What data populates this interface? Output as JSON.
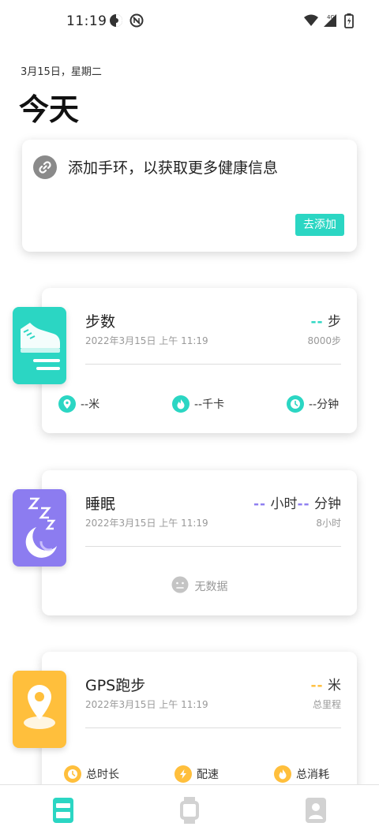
{
  "status_bar": {
    "time": "11:19"
  },
  "header": {
    "date": "3月15日，星期二",
    "title": "今天"
  },
  "add_band": {
    "message": "添加手环，以获取更多健康信息",
    "button": "去添加"
  },
  "steps": {
    "title": "步数",
    "timestamp": "2022年3月15日 上午 11:19",
    "value": "--",
    "unit": "步",
    "goal": "8000步",
    "stats": [
      {
        "label": "--米",
        "icon": "location-pin-icon"
      },
      {
        "label": "--千卡",
        "icon": "flame-icon"
      },
      {
        "label": "--分钟",
        "icon": "clock-icon"
      }
    ]
  },
  "sleep": {
    "title": "睡眠",
    "timestamp": "2022年3月15日 上午 11:19",
    "hours_value": "--",
    "hours_unit": "小时",
    "minutes_value": "--",
    "minutes_unit": "分钟",
    "goal": "8小时",
    "no_data": "无数据"
  },
  "gps": {
    "title": "GPS跑步",
    "timestamp": "2022年3月15日 上午 11:19",
    "value": "--",
    "unit": "米",
    "sub": "总里程",
    "stats": [
      {
        "label": "总时长",
        "icon": "clock-icon"
      },
      {
        "label": "配速",
        "icon": "lightning-icon"
      },
      {
        "label": "总消耗",
        "icon": "flame-icon"
      }
    ]
  },
  "colors": {
    "teal": "#2bd6c3",
    "purple": "#8c7cf0",
    "orange": "#ffbf3c"
  },
  "tabs": [
    {
      "name": "today",
      "icon": "today-tab-icon",
      "active": true
    },
    {
      "name": "device",
      "icon": "watch-tab-icon",
      "active": false
    },
    {
      "name": "profile",
      "icon": "profile-tab-icon",
      "active": false
    }
  ]
}
